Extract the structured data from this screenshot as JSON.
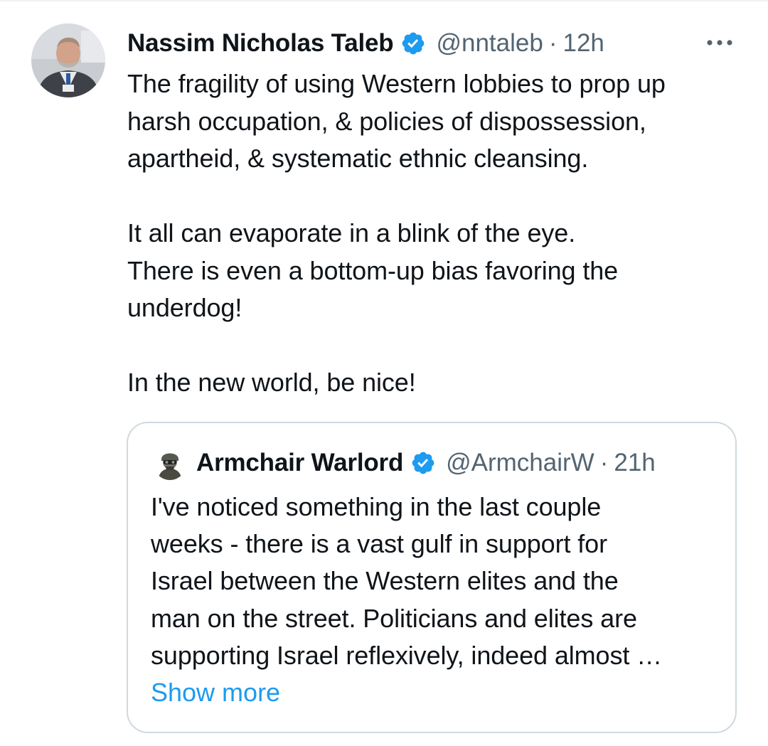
{
  "tweet": {
    "author_name": "Nassim Nicholas Taleb",
    "handle": "@nntaleb",
    "separator": "·",
    "time": "12h",
    "text": "The fragility of using Western lobbies to prop up\nharsh occupation, & policies of dispossession,\napartheid, & systematic ethnic cleansing.\n\nIt all can evaporate in a blink of the eye.\nThere is even a bottom-up bias favoring the\nunderdog!\n\nIn the new world, be nice!"
  },
  "quote": {
    "author_name": "Armchair Warlord",
    "handle": "@ArmchairW",
    "separator": "·",
    "time": "21h",
    "text": "I've noticed something in the last couple\nweeks - there is a vast gulf in support for\nIsrael between the Western elites and the\nman on the street.  Politicians and elites are\nsupporting Israel reflexively, indeed almost …",
    "show_more_label": "Show more"
  },
  "colors": {
    "primary_text": "#0f1419",
    "secondary_text": "#536471",
    "accent": "#1d9bf0",
    "border": "#cfd9de"
  },
  "icons": {
    "verified": "verified-badge-icon",
    "more": "more-horizontal-icon"
  }
}
